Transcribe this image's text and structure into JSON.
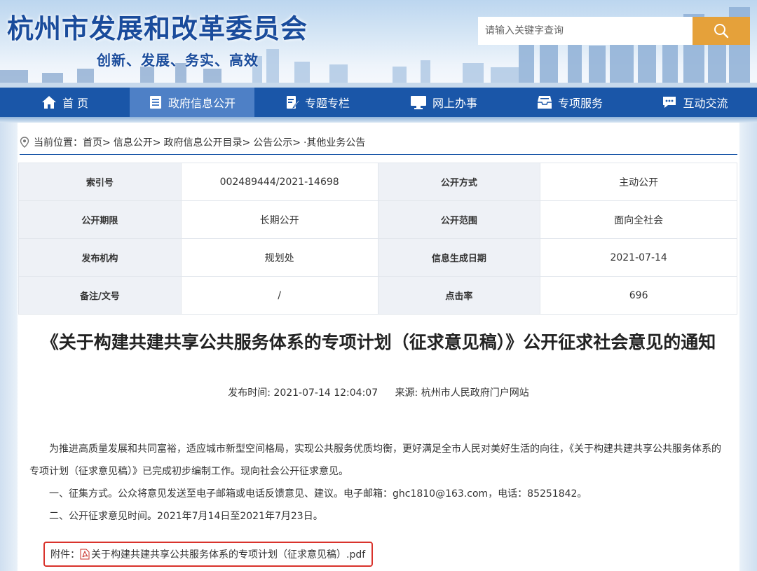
{
  "header": {
    "site_title": "杭州市发展和改革委员会",
    "slogan": "创新、发展、务实、高效",
    "search_placeholder": "请输入关键字查询"
  },
  "nav": {
    "items": [
      {
        "label": "首 页",
        "icon": "home-icon"
      },
      {
        "label": "政府信息公开",
        "icon": "document-list-icon"
      },
      {
        "label": "专题专栏",
        "icon": "edit-note-icon"
      },
      {
        "label": "网上办事",
        "icon": "monitor-icon"
      },
      {
        "label": "专项服务",
        "icon": "inbox-icon"
      },
      {
        "label": "互动交流",
        "icon": "chat-icon"
      }
    ],
    "active_index": 1
  },
  "breadcrumb": {
    "prefix": "当前位置：",
    "items": [
      "首页>",
      "信息公开>",
      "政府信息公开目录>",
      "公告公示>",
      "·其他业务公告"
    ]
  },
  "meta_table": {
    "rows": [
      {
        "k1": "索引号",
        "v1": "002489444/2021-14698",
        "k2": "公开方式",
        "v2": "主动公开"
      },
      {
        "k1": "公开期限",
        "v1": "长期公开",
        "k2": "公开范围",
        "v2": "面向全社会"
      },
      {
        "k1": "发布机构",
        "v1": "规划处",
        "k2": "信息生成日期",
        "v2": "2021-07-14"
      },
      {
        "k1": "备注/文号",
        "v1": "/",
        "k2": "点击率",
        "v2": "696"
      }
    ]
  },
  "article": {
    "title": "《关于构建共建共享公共服务体系的专项计划（征求意见稿）》公开征求社会意见的通知",
    "publish_time": "发布时间: 2021-07-14 12:04:07",
    "source": "来源: 杭州市人民政府门户网站",
    "paragraphs": [
      "为推进高质量发展和共同富裕，适应城市新型空间格局，实现公共服务优质均衡，更好满足全市人民对美好生活的向往，《关于构建共建共享公共服务体系的专项计划（征求意见稿）》已完成初步编制工作。现向社会公开征求意见。",
      "一、征集方式。公众将意见发送至电子邮箱或电话反馈意见、建议。电子邮箱：ghc1810@163.com，电话：85251842。",
      "二、公开征求意见时间。2021年7月14日至2021年7月23日。"
    ],
    "attachment_label": "附件：",
    "attachment_file": "关于构建共建共享公共服务体系的专项计划（征求意见稿）.pdf"
  },
  "colors": {
    "nav_bg": "#1a56a8",
    "nav_active": "#4e80c6",
    "search_button": "#e5a13a",
    "title_blue": "#1a4c9c",
    "attachment_border": "#d9332c"
  }
}
